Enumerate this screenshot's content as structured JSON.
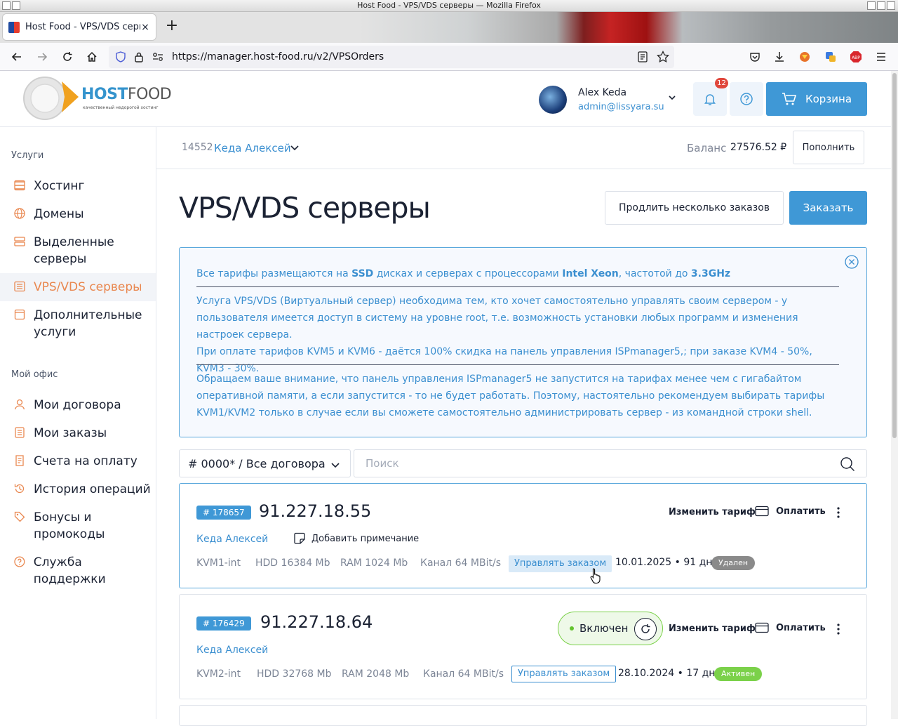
{
  "window": {
    "title": "Host Food - VPS/VDS серверы — Mozilla Firefox"
  },
  "tab": {
    "label": "Host Food - VPS/VDS сервер",
    "close": "×",
    "new_tab": "+"
  },
  "address": {
    "url": "https://manager.host-food.ru/v2/VPSOrders"
  },
  "logo": {
    "brand_a": "HOST",
    "brand_b": "FOOD",
    "tagline": "качественный недорогой хостинг"
  },
  "user": {
    "name": "Alex Keda",
    "email": "admin@lissyara.su"
  },
  "notifications": {
    "count": "12"
  },
  "cart": {
    "label": "Корзина"
  },
  "colors": {
    "accent": "#3f98d6",
    "link": "#3b8fd0",
    "active_nav": "#e9874f",
    "status_active": "#7bd14a",
    "status_deleted": "#8a8a8a",
    "badge": "#e0473c"
  },
  "sidebar": {
    "services_heading": "Услуги",
    "services": [
      {
        "label": "Хостинг",
        "icon": "hosting-icon"
      },
      {
        "label": "Домены",
        "icon": "globe-icon"
      },
      {
        "label": "Выделенные серверы",
        "icon": "server-icon"
      },
      {
        "label": "VPS/VDS серверы",
        "icon": "vps-icon",
        "active": true
      },
      {
        "label": "Дополнительные услуги",
        "icon": "addons-icon"
      }
    ],
    "office_heading": "Мой офис",
    "office": [
      {
        "label": "Мои договора",
        "icon": "contracts-icon"
      },
      {
        "label": "Мои заказы",
        "icon": "orders-icon"
      },
      {
        "label": "Счета на оплату",
        "icon": "invoices-icon"
      },
      {
        "label": "История операций",
        "icon": "history-icon"
      },
      {
        "label": "Бонусы и промокоды",
        "icon": "tag-icon"
      },
      {
        "label": "Служба поддержки",
        "icon": "support-icon"
      }
    ]
  },
  "contract": {
    "id": "14552",
    "name": "Кеда Алексей",
    "balance_label": "Баланс",
    "balance": "27576.52 ₽",
    "topup": "Пополнить"
  },
  "page": {
    "title": "VPS/VDS серверы",
    "renew_multiple": "Продлить несколько заказов",
    "order": "Заказать"
  },
  "info": {
    "l1_a": "Все тарифы размещаются на ",
    "l1_b": "SSD",
    "l1_c": " дисках и серверах с процессорами ",
    "l1_d": "Intel Xeon",
    "l1_e": ", частотой до ",
    "l1_f": "3.3GHz",
    "p2": "Услуга VPS/VDS (Виртуальный сервер) необходима тем, кто хочет самостоятельно управлять своим сервером - у пользователя имеется доступ в систему на уровне root, т.е. возможность установки любых программ и изменения настроек сервера.",
    "p3": "При оплате тарифов KVM5 и KVM6 - даётся 100% скидка на панель управления ISPmanager5,; при заказе KVM4 - 50%, KVM3 - 30%.",
    "p4": "Обращаем ваше внимание, что панель управления ISPmanager5 не запустится на тарифах менее чем с гигабайтом оперативной памяти, а если запустится - то не будет работать. Поэтому, настоятельно рекомендуем выбирать тарифы KVM1/KVM2 только в случае если вы сможете самостоятельно администрировать сервер - из командной строки shell."
  },
  "filter": {
    "contract_select": "# 0000* / Все договора",
    "search_placeholder": "Поиск"
  },
  "orders": [
    {
      "id": "# 178657",
      "ip": "91.227.18.55",
      "owner": "Кеда Алексей",
      "add_note": "Добавить примечание",
      "tariff": "KVM1-int",
      "hdd": "HDD 16384 Mb",
      "ram": "RAM 1024 Mb",
      "channel": "Канал 64 MBit/s",
      "manage": "Управлять заказом",
      "date": "10.01.2025",
      "days": "91 дн.",
      "status": "Удален",
      "change_tariff": "Изменить тариф",
      "pay": "Оплатить"
    },
    {
      "id": "# 176429",
      "ip": "91.227.18.64",
      "owner": "Кеда Алексей",
      "power": "Включен",
      "tariff": "KVM2-int",
      "hdd": "HDD 32768 Mb",
      "ram": "RAM 2048 Mb",
      "channel": "Канал 64 MBit/s",
      "manage": "Управлять заказом",
      "date": "28.10.2024",
      "days": "17 дн.",
      "status": "Активен",
      "change_tariff": "Изменить тариф",
      "pay": "Оплатить"
    }
  ],
  "separator": "•"
}
